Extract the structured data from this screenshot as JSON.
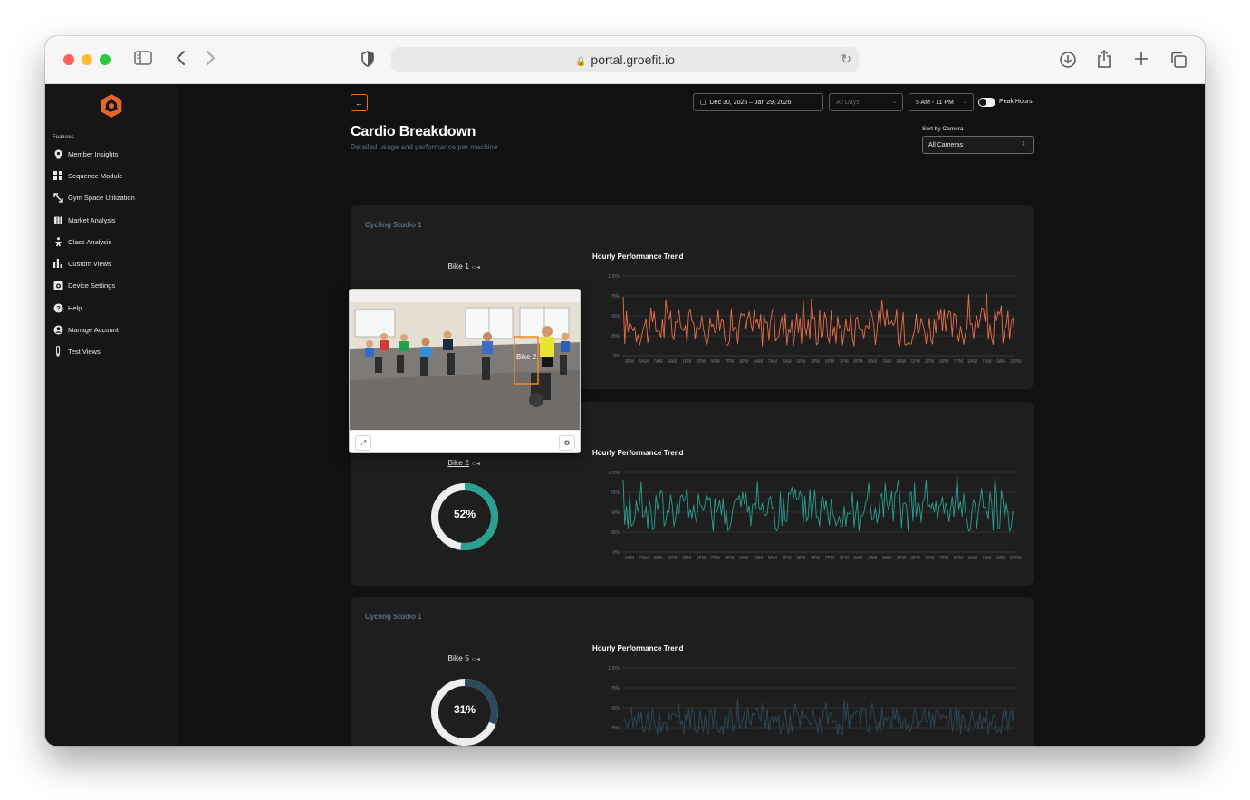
{
  "browser": {
    "url": "portal.groefit.io"
  },
  "sidebar": {
    "section_label": "Features",
    "items": [
      {
        "label": "Member Insights",
        "icon": "lightbulb-icon"
      },
      {
        "label": "Sequence Module",
        "icon": "grid-icon"
      },
      {
        "label": "Gym Space Utilization",
        "icon": "resize-arrows-icon"
      },
      {
        "label": "Market Analysis",
        "icon": "map-icon"
      },
      {
        "label": "Class Analysis",
        "icon": "person-exercise-icon"
      },
      {
        "label": "Custom Views",
        "icon": "bar-chart-icon"
      },
      {
        "label": "Device Settings",
        "icon": "camera-icon"
      },
      {
        "label": "Help",
        "icon": "question-icon"
      },
      {
        "label": "Manage Account",
        "icon": "user-circle-icon"
      },
      {
        "label": "Test Views",
        "icon": "thermometer-icon"
      }
    ]
  },
  "toolbar": {
    "date_range": "Dec 30, 2025 – Jan 29, 2026",
    "days_placeholder": "All Days",
    "time_range": "5 AM - 11 PM",
    "peak_hours_label": "Peak Hours"
  },
  "header": {
    "title": "Cardio Breakdown",
    "subtitle": "Detailed usage and performance per machine",
    "sort_label": "Sort by Camera",
    "sort_value": "All Cameras"
  },
  "colors": {
    "accent": "#e8652e",
    "bike1_line": "#e8704a",
    "bike2_line": "#2aa090",
    "bike5_line": "#2c4a5c",
    "donut_track": "#eeeeee"
  },
  "cards": [
    {
      "title": "Cycling Studio 1",
      "bike": "Bike 1",
      "trend_title": "Hourly Performance Trend",
      "x_ticks": [
        "9PM",
        "5AM",
        "7AM",
        "9AM",
        "1PM",
        "3PM",
        "5PM",
        "7PM",
        "9PM",
        "5AM",
        "7AM",
        "9AM",
        "1PM",
        "3PM",
        "5PM",
        "7PM",
        "9PM",
        "5AM",
        "7AM",
        "9AM",
        "1PM",
        "3PM",
        "5PM",
        "7PM",
        "5AM",
        "7AM",
        "9AM",
        "10PM"
      ]
    },
    {
      "title": "",
      "bike": "Bike 2",
      "percent": 52,
      "percent_label": "52%",
      "trend_title": "Hourly Performance Trend",
      "x_ticks": [
        "5AM",
        "7AM",
        "9AM",
        "1PM",
        "3PM",
        "5PM",
        "7PM",
        "9PM",
        "5AM",
        "7AM",
        "9AM",
        "1PM",
        "3PM",
        "5PM",
        "7PM",
        "9PM",
        "5AM",
        "7AM",
        "9AM",
        "1PM",
        "3PM",
        "5PM",
        "7PM",
        "9PM",
        "5AM",
        "7AM",
        "9AM",
        "10PM"
      ]
    },
    {
      "title": "Cycling Studio 1",
      "bike": "Bike 5",
      "percent": 31,
      "percent_label": "31%",
      "trend_title": "Hourly Performance Trend",
      "x_ticks": [
        "5AM",
        "7AM",
        "9AM",
        "1PM",
        "3PM",
        "5PM",
        "7PM",
        "9PM",
        "5AM",
        "7AM",
        "9AM",
        "1PM",
        "3PM",
        "5PM",
        "7PM",
        "9PM",
        "5AM",
        "7AM",
        "9AM",
        "1PM",
        "3PM",
        "5PM",
        "7PM",
        "9PM",
        "5AM",
        "7AM",
        "9AM",
        "10PM"
      ]
    }
  ],
  "y_ticks": [
    "100%",
    "75%",
    "50%",
    "25%",
    "0%"
  ],
  "camera_popup": {
    "detection_label": "Bike 2"
  }
}
